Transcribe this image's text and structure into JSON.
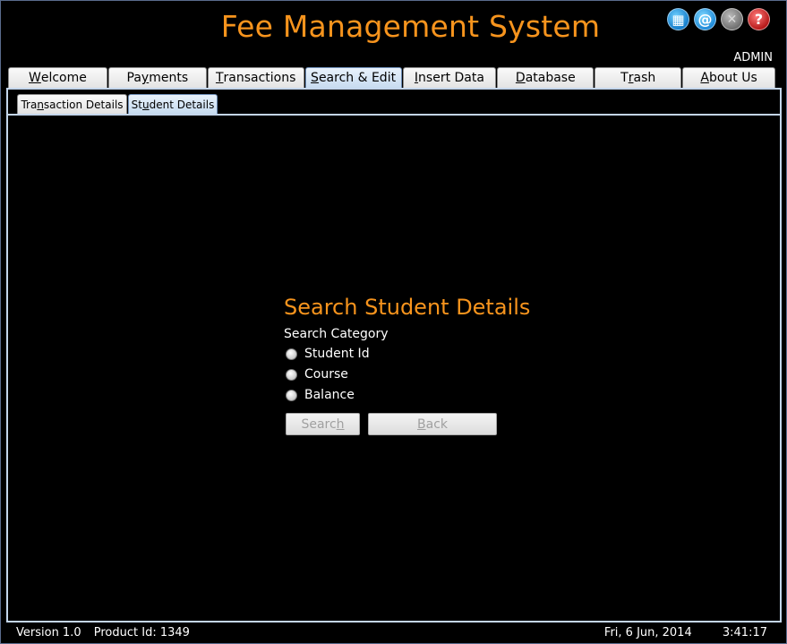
{
  "app": {
    "title": "Fee Management System",
    "user": "ADMIN"
  },
  "window_icons": [
    {
      "name": "dashboard-icon",
      "glyph": "▦"
    },
    {
      "name": "email-icon",
      "glyph": "@"
    },
    {
      "name": "close-icon",
      "glyph": "✕"
    },
    {
      "name": "help-icon",
      "glyph": "?"
    }
  ],
  "main_tabs": [
    {
      "pre": "",
      "u": "W",
      "post": "elcome"
    },
    {
      "pre": "Pa",
      "u": "y",
      "post": "ments"
    },
    {
      "pre": "",
      "u": "T",
      "post": "ransactions"
    },
    {
      "pre": "",
      "u": "S",
      "post": "earch & Edit"
    },
    {
      "pre": "",
      "u": "I",
      "post": "nsert Data"
    },
    {
      "pre": "",
      "u": "D",
      "post": "atabase"
    },
    {
      "pre": "T",
      "u": "r",
      "post": "ash"
    },
    {
      "pre": "",
      "u": "A",
      "post": "bout Us"
    }
  ],
  "sub_tabs": [
    {
      "pre": "Tra",
      "u": "n",
      "post": "saction Details"
    },
    {
      "pre": "St",
      "u": "u",
      "post": "dent Details"
    }
  ],
  "search_panel": {
    "heading": "Search Student Details",
    "category_label": "Search Category",
    "options": [
      "Student Id",
      "Course",
      "Balance"
    ],
    "search_button": {
      "pre": "Searc",
      "u": "h",
      "post": ""
    },
    "back_button": {
      "pre": "",
      "u": "B",
      "post": "ack"
    }
  },
  "status": {
    "version": "Version 1.0",
    "product_id": "Product Id: 1349",
    "date": "Fri, 6 Jun, 2014",
    "time": "3:41:17"
  },
  "colors": {
    "accent": "#f7941d",
    "background": "#000000",
    "frame_border": "#c4d6ec"
  }
}
